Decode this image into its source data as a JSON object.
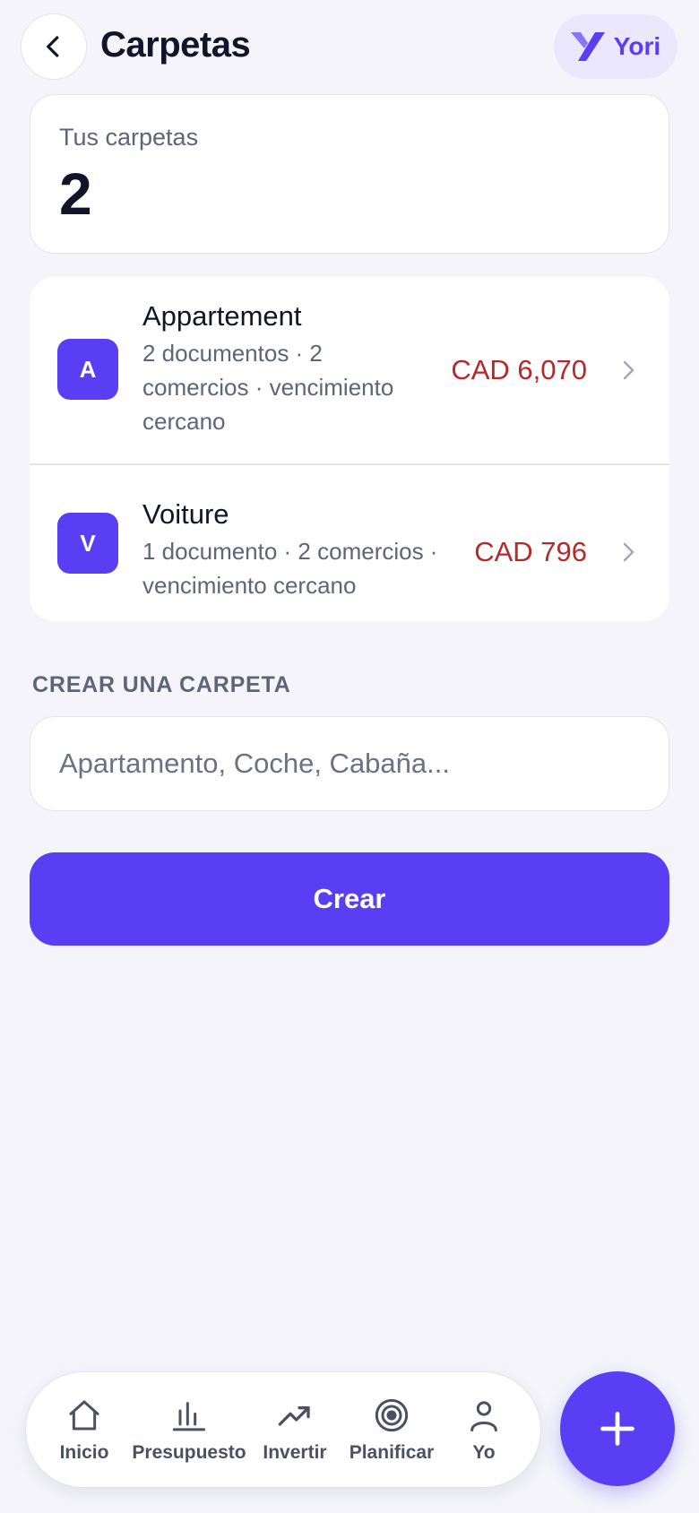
{
  "header": {
    "title": "Carpetas",
    "brand_name": "Yori"
  },
  "summary": {
    "label": "Tus carpetas",
    "count": "2"
  },
  "folders": [
    {
      "initial": "A",
      "name": "Appartement",
      "description": "2 documentos · 2 comercios · vencimiento cercano",
      "amount": "CAD 6,070"
    },
    {
      "initial": "V",
      "name": "Voiture",
      "description": "1 documento · 2 comercios · vencimiento cercano",
      "amount": "CAD 796"
    }
  ],
  "create": {
    "section_label": "CREAR UNA CARPETA",
    "placeholder": "Apartamento, Coche, Cabaña...",
    "button_label": "Crear"
  },
  "nav": {
    "inicio": "Inicio",
    "presupuesto": "Presupuesto",
    "invertir": "Invertir",
    "planificar": "Planificar",
    "yo": "Yo"
  },
  "icons": {
    "back": "chevron-left-icon",
    "brand": "yori-logo-icon",
    "row_chevron": "chevron-right-icon",
    "home": "home-icon",
    "budget": "bar-chart-icon",
    "invest": "trend-up-icon",
    "plan": "target-icon",
    "profile": "user-icon",
    "fab": "plus-icon"
  },
  "colors": {
    "accent": "#5a3ef4",
    "amount_due": "#b42a2a",
    "background": "#f4f4fa"
  }
}
